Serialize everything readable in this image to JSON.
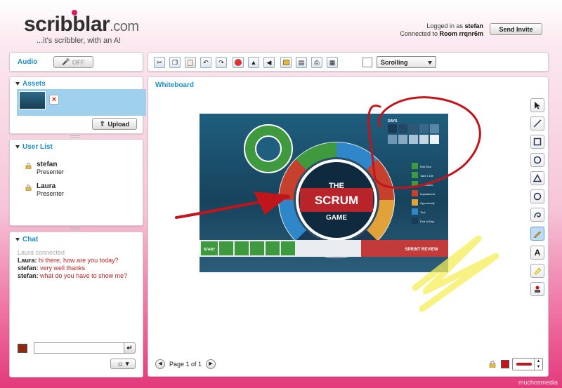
{
  "header": {
    "logo_main": "scribblar",
    "logo_suffix": ".com",
    "tagline": "...it's scribbler, with an A!",
    "logged_in_prefix": "Logged in as",
    "username": "stefan",
    "connected_prefix": "Connected to",
    "room": "Room rrqnr6m",
    "send_invite": "Send Invite"
  },
  "audio": {
    "label": "Audio",
    "toggle": "OFF"
  },
  "assets": {
    "title": "Assets",
    "upload": "Upload"
  },
  "user_list": {
    "title": "User List",
    "users": [
      {
        "name": "stefan",
        "role": "Presenter"
      },
      {
        "name": "Laura",
        "role": "Presenter"
      }
    ]
  },
  "chat": {
    "title": "Chat",
    "system": "Laura connected",
    "messages": [
      {
        "from": "Laura:",
        "text": "hi there, how are you today?"
      },
      {
        "from": "stefan:",
        "text": "very well thanks"
      },
      {
        "from": "stefan:",
        "text": "what do you have to show me?"
      }
    ],
    "input_value": "",
    "color": "#8a2a12"
  },
  "toolbar": {
    "mode": "Scrolling"
  },
  "whiteboard": {
    "title": "Whiteboard",
    "page_label": "Page 1 of 1",
    "pen_color": "#c0151b",
    "highlighter_color": "#f5ee5a",
    "image": {
      "title_line1": "THE",
      "title_line2": "SCRUM",
      "title_line3": "GAME",
      "days_label": "DAYS",
      "start": "START",
      "sprint_review": "SPRINT REVIEW",
      "legend": [
        "Roll Dice",
        "Take 1 Die",
        "Burndown",
        "Impediment",
        "Opportunity",
        "Tool",
        "End of Day"
      ]
    }
  },
  "watermark": "muchosmedia"
}
